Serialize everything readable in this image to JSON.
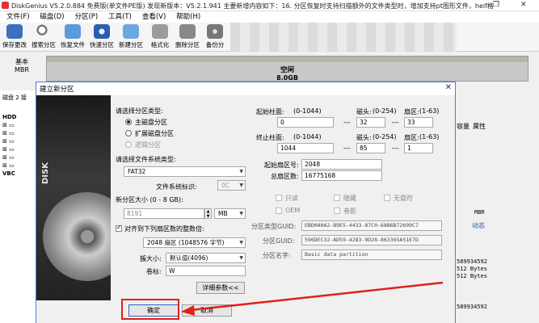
{
  "window": {
    "title": "DiskGenius V5.2.0.884 免费版(单文件PE版)   发现新版本：V5.2.1.941 主要新增内容如下：16. 分区恢复时支持扫描额外的文件类型时，增加支持pt图形文件，heif格"
  },
  "menu": [
    "文件(F)",
    "磁盘(D)",
    "分区(P)",
    "工具(T)",
    "查看(V)",
    "帮助(H)"
  ],
  "toolbar": [
    "保存更改",
    "搜索分区",
    "恢复文件",
    "快速分区",
    "新建分区",
    "格式化",
    "删除分区",
    "备份分"
  ],
  "diskmap": {
    "basic_line1": "基本",
    "basic_line2": "MBR",
    "free_label": "空闲",
    "free_size": "8.0GB"
  },
  "left_panel": {
    "disk_label": "磁盘 2 接",
    "tree": [
      "HDD",
      "",
      "",
      "",
      "",
      "",
      "",
      "",
      "VBC"
    ]
  },
  "right_panel": {
    "col_capacity": "容量",
    "col_attr": "属性",
    "mbr": "MBR",
    "dynamic": "动态",
    "n1": "589934592",
    "n2": "512 Bytes",
    "n3": "512 Bytes",
    "n4": "589934592"
  },
  "dialog": {
    "title": "建立新分区",
    "part_type_label": "请选择分区类型:",
    "opt_primary": "主磁盘分区",
    "opt_extended": "扩展磁盘分区",
    "opt_logical": "逻辑分区",
    "fs_type_label": "请选择文件系统类型:",
    "fs_value": "FAT32",
    "fs_id_label": "文件系统标识:",
    "fs_id_value": "0C",
    "size_label": "新分区大小 (0 - 8 GB):",
    "size_value": "8191",
    "size_unit": "MB",
    "align_label": "对齐到下列扇区数的整数倍:",
    "align_value": "2048 扇区  (1048576 字节)",
    "cluster_label": "簇大小:",
    "cluster_value": "默认值(4096)",
    "volume_label": "卷标:",
    "volume_value": "W",
    "start_cyl_label": "起始柱面:",
    "start_cyl_range": "(0-1044)",
    "start_cyl": "0",
    "head_label": "磁头:",
    "head_range": "(0-254)",
    "sector_label": "扇区:",
    "sector_range": "(1-63)",
    "start_head": "32",
    "start_sector": "33",
    "end_cyl_label": "终止柱面:",
    "end_cyl_range": "(0-1044)",
    "end_cyl": "1044",
    "end_head": "85",
    "end_sector": "1",
    "start_lba_label": "起始扇区号:",
    "start_lba": "2048",
    "total_sectors_label": "总扇区数:",
    "total_sectors": "16775168",
    "dash": "---",
    "attr_readonly": "只读",
    "attr_hidden": "隐藏",
    "attr_nodrive": "无盘符",
    "attr_oem": "OEM",
    "attr_shadow": "卷影",
    "type_guid_label": "分区类型GUID:",
    "type_guid": "EBD0A0A2-B9E5-4433-87C0-68B6B72699C7",
    "part_guid_label": "分区GUID:",
    "part_guid": "596DEC32-AD59-4283-9D28-863365A51E7D",
    "part_name_label": "分区名字:",
    "part_name": "Basic data partition",
    "details_button": "详细参数<<",
    "ok_button": "确定",
    "cancel_button": "取消"
  },
  "colors": {
    "accent": "#4a7fd6",
    "arrow": "#e0201c"
  }
}
